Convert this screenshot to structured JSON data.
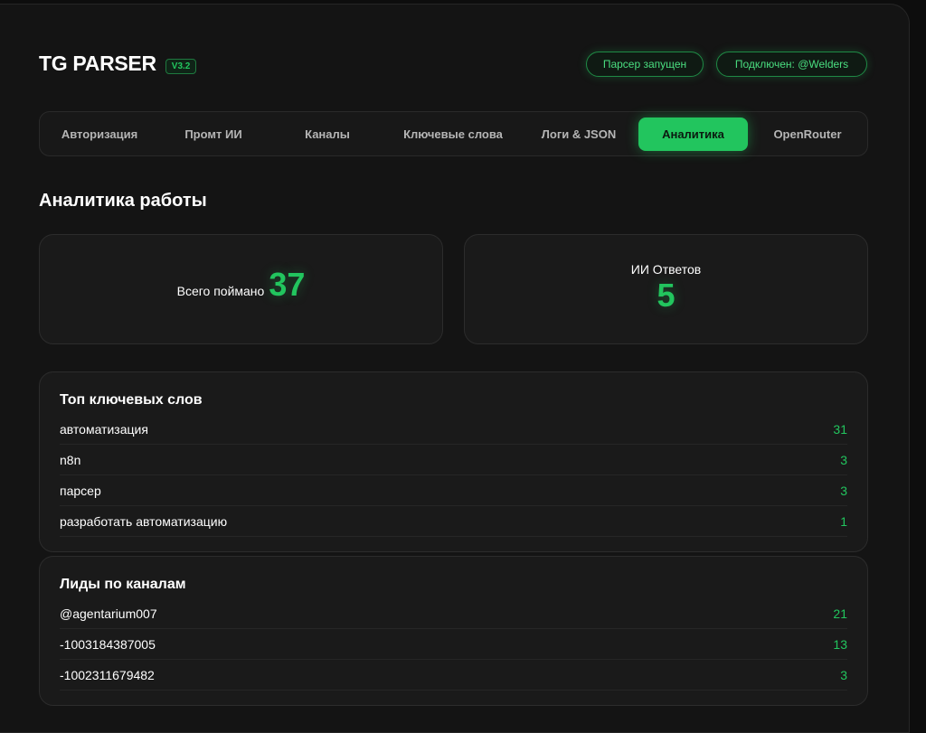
{
  "header": {
    "title": "TG PARSER",
    "version": "V3.2",
    "status_parser": "Парсер запущен",
    "status_connected": "Подключен: @Welders"
  },
  "tabs": [
    {
      "label": "Авторизация",
      "active": false
    },
    {
      "label": "Промт ИИ",
      "active": false
    },
    {
      "label": "Каналы",
      "active": false
    },
    {
      "label": "Ключевые слова",
      "active": false
    },
    {
      "label": "Логи & JSON",
      "active": false
    },
    {
      "label": "Аналитика",
      "active": true
    },
    {
      "label": "OpenRouter",
      "active": false
    }
  ],
  "main": {
    "title": "Аналитика работы",
    "stats": {
      "caught_label": "Всего поймано",
      "caught_value": "37",
      "ai_label": "ИИ Ответов",
      "ai_value": "5"
    },
    "top_keywords": {
      "title": "Топ ключевых слов",
      "rows": [
        {
          "label": "автоматизация",
          "count": "31"
        },
        {
          "label": "n8n",
          "count": "3"
        },
        {
          "label": "парсер",
          "count": "3"
        },
        {
          "label": "разработать автоматизацию",
          "count": "1"
        }
      ]
    },
    "leads_by_channel": {
      "title": "Лиды по каналам",
      "rows": [
        {
          "label": "@agentarium007",
          "count": "21"
        },
        {
          "label": "-1003184387005",
          "count": "13"
        },
        {
          "label": "-1002311679482",
          "count": "3"
        }
      ]
    }
  },
  "colors": {
    "accent": "#22c55e",
    "background": "#141414",
    "card": "#1a1a1a"
  }
}
